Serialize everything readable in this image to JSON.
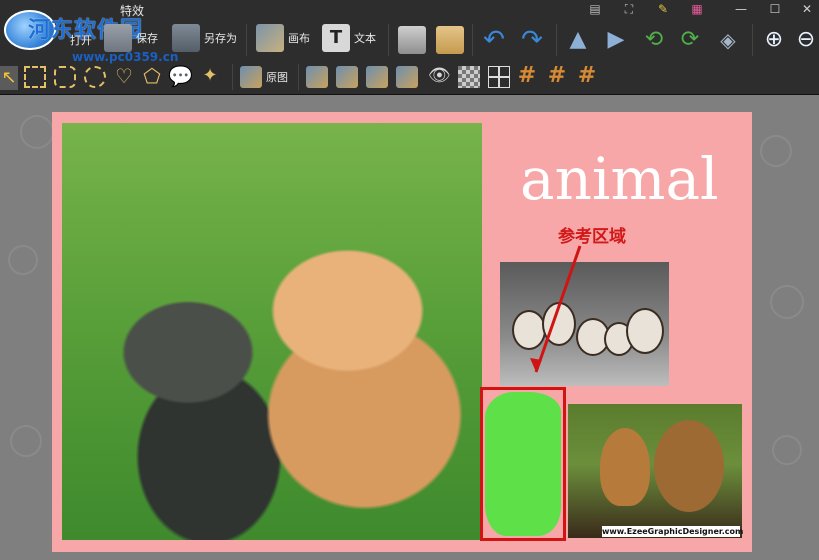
{
  "app": {
    "title": "特效",
    "watermark_text": "河东软件园",
    "watermark_url": "www.pc0359.cn"
  },
  "toolbar": {
    "open_label": "打开",
    "save_label": "保存",
    "saveas_label": "另存为",
    "canvas_label": "画布",
    "text_label": "文本",
    "original_label": "原图"
  },
  "canvas": {
    "heading": "animal",
    "reference_label": "参考区域",
    "credit": "www.EzeeGraphicDesigner.com"
  },
  "colors": {
    "page_bg": "#f7a7a7",
    "ref_box": "#d01414",
    "blob": "#5ee048"
  }
}
